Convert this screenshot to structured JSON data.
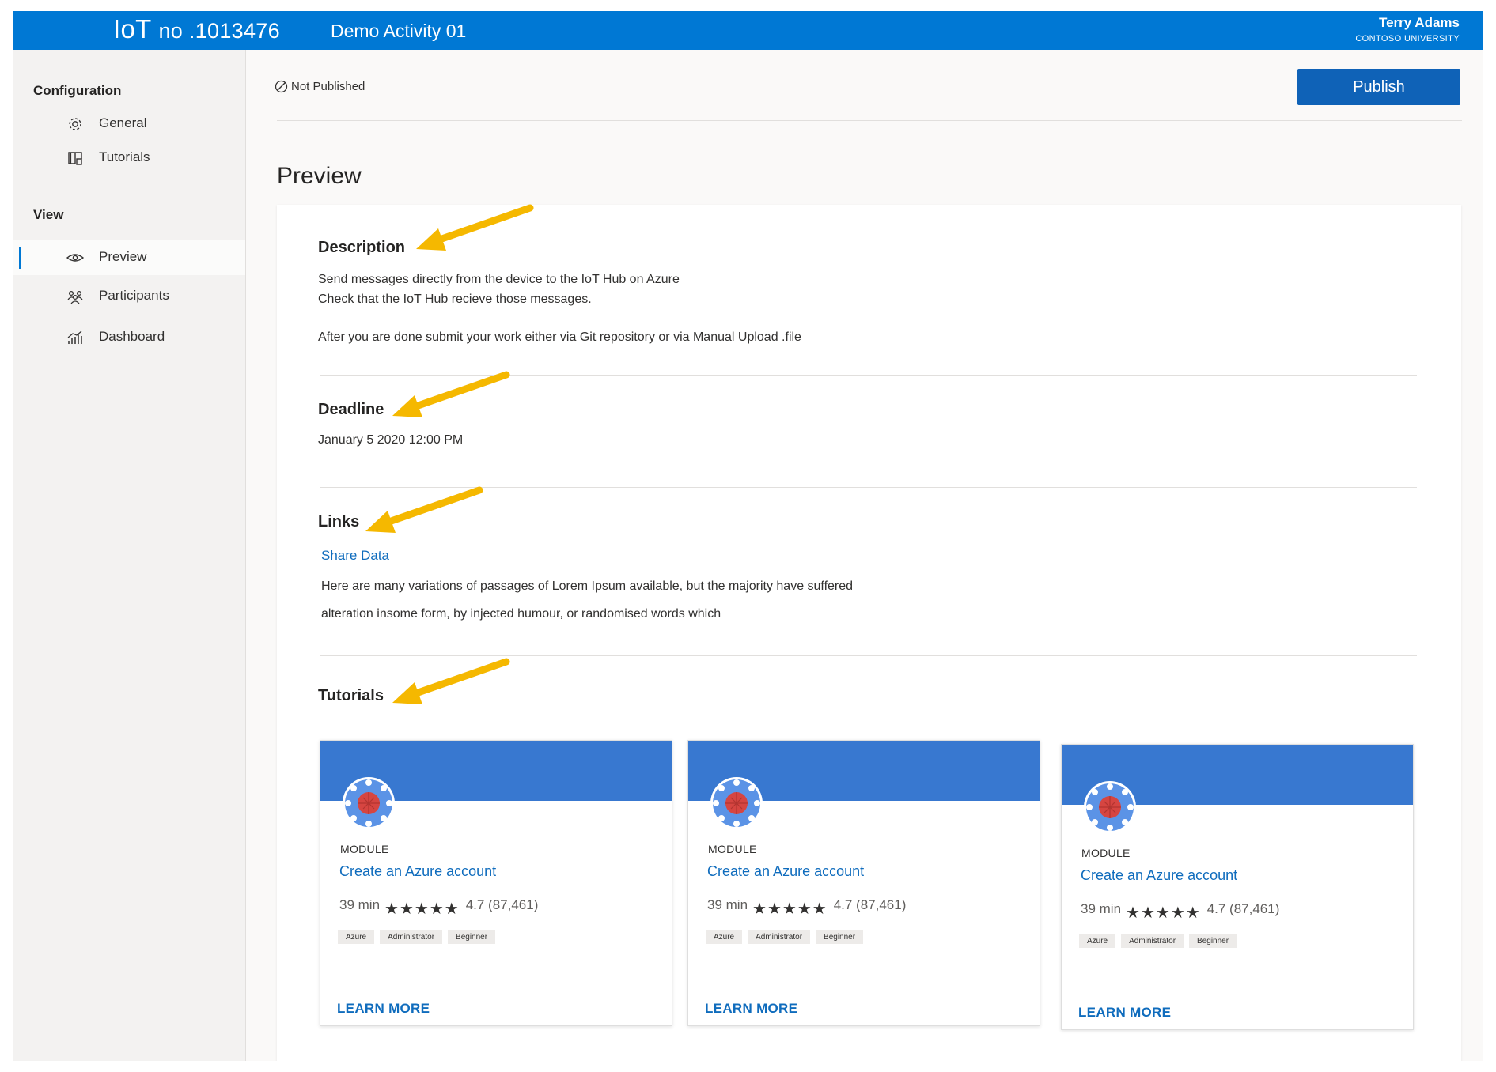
{
  "header": {
    "app_title_main": "IoT",
    "app_title_no": "no .1013476",
    "activity": "Demo Activity 01",
    "user_name": "Terry Adams",
    "user_org": "CONTOSO UNIVERSITY"
  },
  "sidebar": {
    "configuration_heading": "Configuration",
    "view_heading": "View",
    "items": [
      {
        "label": "General",
        "icon": "gear-icon"
      },
      {
        "label": "Tutorials",
        "icon": "book-icon"
      },
      {
        "label": "Preview",
        "icon": "eye-icon",
        "active": true
      },
      {
        "label": "Participants",
        "icon": "people-icon"
      },
      {
        "label": "Dashboard",
        "icon": "chart-icon"
      }
    ]
  },
  "main": {
    "status": "Not Published",
    "publish_label": "Publish",
    "page_title": "Preview"
  },
  "preview": {
    "description_title": "Description",
    "description_lines": [
      "Send messages directly from the device to the IoT Hub on Azure",
      "Check that the IoT Hub recieve those messages.",
      "After you are done submit your work either via Git repository or via Manual Upload .file"
    ],
    "deadline_title": "Deadline",
    "deadline_value": "January 5 2020 12:00 PM",
    "links_title": "Links",
    "link_label": "Share Data",
    "links_text_lines": [
      "Here are many variations of passages of Lorem Ipsum available, but the majority have suffered",
      "alteration insome form, by injected humour, or randomised words which"
    ],
    "tutorials_title": "Tutorials"
  },
  "tutorials": [
    {
      "type": "MODULE",
      "title": "Create an Azure account",
      "duration": "39 min",
      "stars": "★★★★★",
      "rating": "4.7 (87,461)",
      "tags": [
        "Azure",
        "Administrator",
        "Beginner"
      ],
      "cta": "LEARN MORE"
    },
    {
      "type": "MODULE",
      "title": "Create an Azure account",
      "duration": "39 min",
      "stars": "★★★★★",
      "rating": "4.7 (87,461)",
      "tags": [
        "Azure",
        "Administrator",
        "Beginner"
      ],
      "cta": "LEARN MORE"
    },
    {
      "type": "MODULE",
      "title": "Create an Azure account",
      "duration": "39 min",
      "stars": "★★★★★",
      "rating": "4.7 (87,461)",
      "tags": [
        "Azure",
        "Administrator",
        "Beginner"
      ],
      "cta": "LEARN MORE"
    }
  ],
  "colors": {
    "brand": "#0078d4",
    "publish": "#0f62b7",
    "link": "#0f6cbd",
    "tile_banner": "#3878d0",
    "annotation_arrow": "#f5b800"
  }
}
